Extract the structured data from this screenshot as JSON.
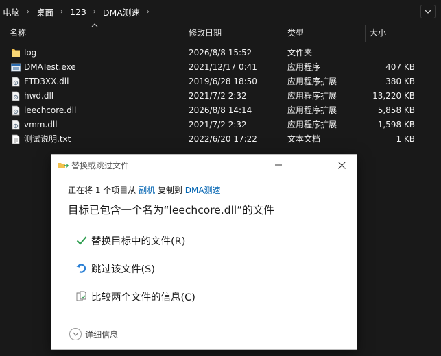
{
  "address": {
    "crumbs": [
      "电脑",
      "桌面",
      "123",
      "DMA测速"
    ],
    "separator": "›"
  },
  "columns": {
    "name": "名称",
    "date": "修改日期",
    "type": "类型",
    "size": "大小"
  },
  "files": [
    {
      "name": "log",
      "date": "2026/8/8 15:52",
      "type": "文件夹",
      "size": "",
      "icon": "folder-icon"
    },
    {
      "name": "DMATest.exe",
      "date": "2021/12/17 0:41",
      "type": "应用程序",
      "size": "407 KB",
      "icon": "exe-icon"
    },
    {
      "name": "FTD3XX.dll",
      "date": "2019/6/28 18:50",
      "type": "应用程序扩展",
      "size": "380 KB",
      "icon": "dll-icon"
    },
    {
      "name": "hwd.dll",
      "date": "2021/7/2 2:32",
      "type": "应用程序扩展",
      "size": "13,220 KB",
      "icon": "dll-icon"
    },
    {
      "name": "leechcore.dll",
      "date": "2026/8/8 14:14",
      "type": "应用程序扩展",
      "size": "5,858 KB",
      "icon": "dll-icon"
    },
    {
      "name": "vmm.dll",
      "date": "2021/7/2 2:32",
      "type": "应用程序扩展",
      "size": "1,598 KB",
      "icon": "dll-icon"
    },
    {
      "name": "测试说明.txt",
      "date": "2022/6/20 17:22",
      "type": "文本文档",
      "size": "1 KB",
      "icon": "txt-icon"
    }
  ],
  "dialog": {
    "title": "替换或跳过文件",
    "line1_prefix": "正在将 1 个项目从 ",
    "line1_source": "副机",
    "line1_middle": " 复制到 ",
    "line1_dest": "DMA测速",
    "line2": "目标已包含一个名为“leechcore.dll”的文件",
    "options": {
      "replace": "替换目标中的文件(R)",
      "skip": "跳过该文件(S)",
      "compare": "比较两个文件的信息(C)"
    },
    "details": "详细信息"
  },
  "colors": {
    "background": "#191919",
    "link": "#0063b1",
    "check": "#2e9e4f",
    "skip": "#2a7fd4",
    "folder": "#f2c14e"
  }
}
